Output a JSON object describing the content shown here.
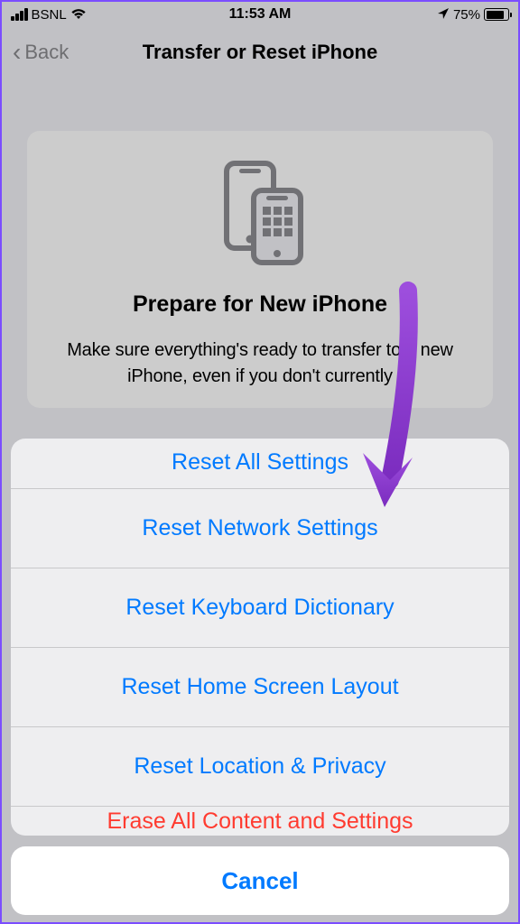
{
  "status": {
    "carrier": "BSNL",
    "time": "11:53 AM",
    "battery_percent": "75%"
  },
  "nav": {
    "back_label": "Back",
    "title": "Transfer or Reset iPhone"
  },
  "card": {
    "title": "Prepare for New iPhone",
    "description": "Make sure everything's ready to transfer to a new iPhone, even if you don't currently"
  },
  "action_sheet": {
    "items": [
      "Reset All Settings",
      "Reset Network Settings",
      "Reset Keyboard Dictionary",
      "Reset Home Screen Layout",
      "Reset Location & Privacy"
    ],
    "peek_item": "Erase All Content and Settings",
    "cancel": "Cancel"
  },
  "colors": {
    "ios_blue": "#007aff",
    "ios_red": "#ff3b30",
    "arrow": "#8a2be2"
  }
}
